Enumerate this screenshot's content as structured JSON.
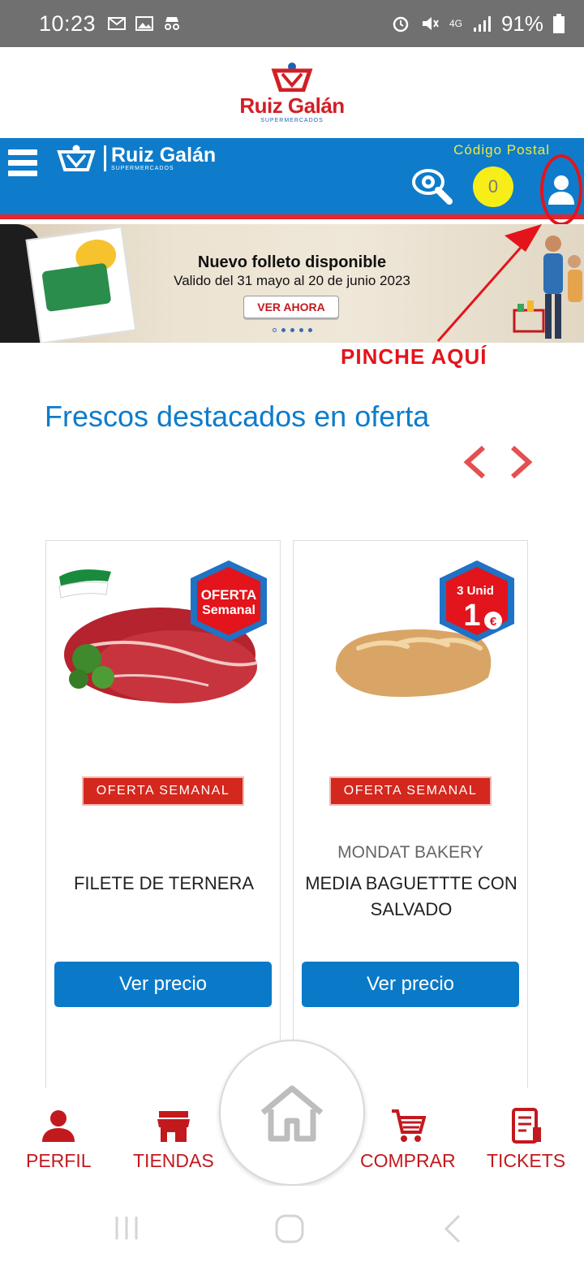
{
  "status_bar": {
    "time": "10:23",
    "battery": "91%",
    "network": "4G"
  },
  "top_logo": {
    "brand": "Ruiz Galán",
    "subtitle": "SUPERMERCADOS"
  },
  "header": {
    "brand": "Ruiz Galán",
    "subtitle": "SUPERMERCADOS",
    "postal_code_label": "Código Postal",
    "cart_count": "0",
    "icons": [
      "menu-icon",
      "eye-search-icon",
      "user-icon"
    ]
  },
  "banner": {
    "title": "Nuevo folleto disponible",
    "subtitle": "Valido del 31 mayo al 20 de junio 2023",
    "cta": "VER AHORA"
  },
  "annotation": {
    "text": "PINCHE AQUÍ"
  },
  "section": {
    "title": "Frescos destacados en oferta"
  },
  "products": [
    {
      "badge": "OFERTA SEMANAL",
      "image_badge": "OFERTA Semanal",
      "brand": "",
      "name": "FILETE DE TERNERA",
      "button": "Ver precio"
    },
    {
      "badge": "OFERTA SEMANAL",
      "image_badge_top": "3 Unid",
      "image_badge_main": "1",
      "image_badge_currency": "€",
      "brand": "MONDAT BAKERY",
      "name": "MEDIA BAGUETTTE CON SALVADO",
      "button": "Ver precio"
    }
  ],
  "bottom_nav": {
    "items": [
      "PERFIL",
      "TIENDAS",
      "COMPRAR",
      "TICKETS"
    ]
  },
  "colors": {
    "brand_blue": "#0e7ccb",
    "brand_red": "#d21f26",
    "cart_yellow": "#f8ee17"
  }
}
